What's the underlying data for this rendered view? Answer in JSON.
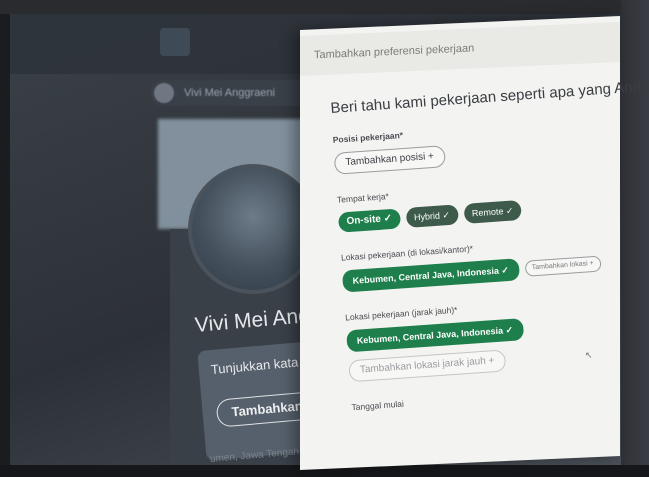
{
  "background_profile": {
    "user_name": "Vivi Mei Anggraeni",
    "profile_name": "Vivi Mei Anggra",
    "open_to_work_text": "Tunjukkan kata ganti d",
    "open_to_work_button": "Tambahkan kata g",
    "location": "umen, Jawa Tengah, Ind"
  },
  "modal": {
    "title": "Tambahkan preferensi pekerjaan",
    "heading": "Beri tahu kami pekerjaan seperti apa yang Anda cari",
    "job_position": {
      "label": "Posisi pekerjaan*",
      "add_button": "Tambahkan posisi +"
    },
    "workplace": {
      "label": "Tempat kerja*",
      "options": [
        "On-site ✓",
        "Hybrid ✓",
        "Remote ✓"
      ]
    },
    "onsite_location": {
      "label": "Lokasi pekerjaan (di lokasi/kantor)*",
      "selected": "Kebumen, Central Java, Indonesia ✓",
      "add_button": "Tambahkan lokasi +"
    },
    "remote_location": {
      "label": "Lokasi pekerjaan (jarak jauh)*",
      "selected": "Kebumen, Central Java, Indonesia ✓",
      "add_button": "Tambahkan lokasi jarak jauh +"
    },
    "start_date": {
      "label": "Tanggal mulai"
    }
  },
  "colors": {
    "accent_green": "#1f7f4c",
    "modal_bg": "#f3f3f1"
  }
}
